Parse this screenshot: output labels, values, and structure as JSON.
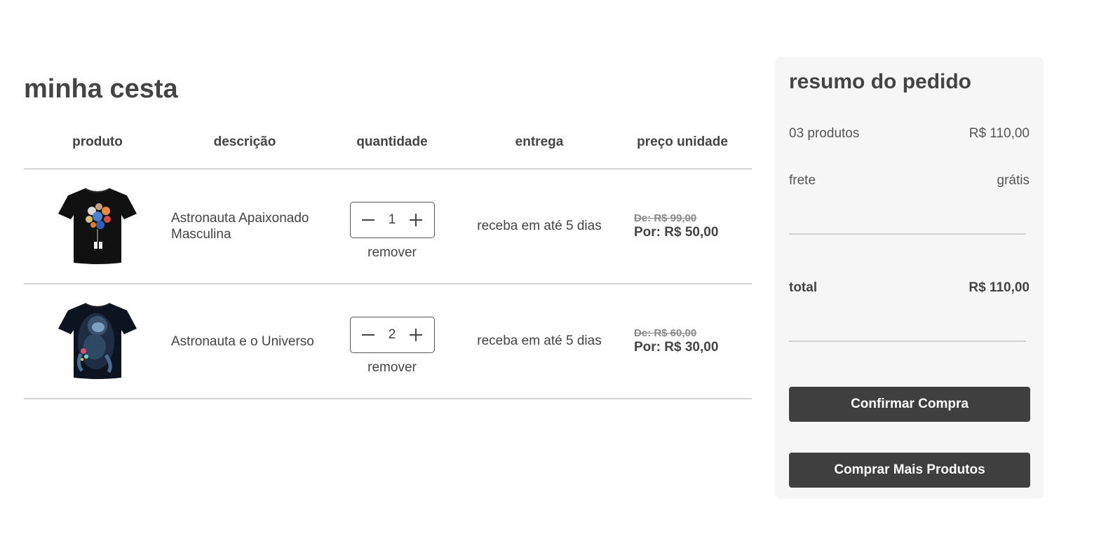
{
  "cart": {
    "title": "minha cesta",
    "columns": [
      "produto",
      "descrição",
      "quantidade",
      "entrega",
      "preço unidade"
    ],
    "items": [
      {
        "image_icon": "black-tshirt-astronaut-planets",
        "description": "Astronauta Apaixonado Masculina",
        "quantity": "1",
        "remove_label": "remover",
        "delivery": "receba em até 5 dias",
        "old_price": "De: R$ 99,00",
        "new_price": "Por: R$ 50,00"
      },
      {
        "image_icon": "black-tshirt-astronaut-universe",
        "description": "Astronauta e o Universo",
        "quantity": "2",
        "remove_label": "remover",
        "delivery": "receba em até 5 dias",
        "old_price": "De: R$ 60,00",
        "new_price": "Por: R$ 30,00"
      }
    ]
  },
  "summary": {
    "title": "resumo do pedido",
    "products_label": "03 produtos",
    "products_value": "R$ 110,00",
    "shipping_label": "frete",
    "shipping_value": "grátis",
    "total_label": "total",
    "total_value": "R$ 110,00",
    "confirm_button": "Confirmar Compra",
    "more_button": "Comprar Mais Produtos"
  },
  "colors": {
    "text": "#444444",
    "button_bg": "#3f3f3f",
    "panel_bg": "#f6f6f6",
    "divider": "#d4d4d4"
  }
}
